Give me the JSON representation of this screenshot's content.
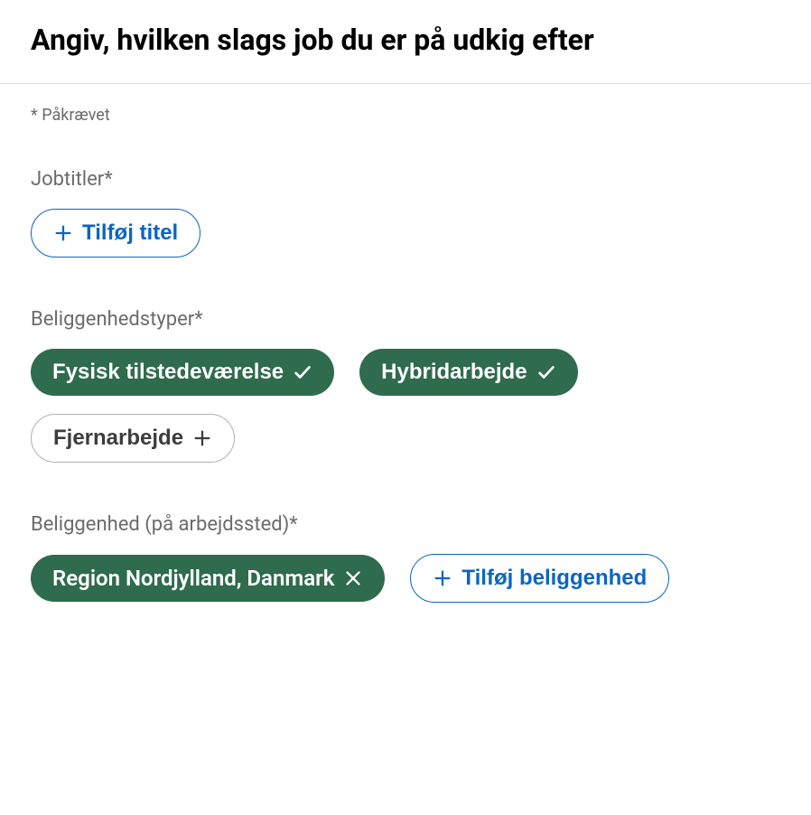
{
  "page": {
    "title": "Angiv, hvilken slags job du er på udkig efter",
    "required_hint": "* Påkrævet"
  },
  "jobTitles": {
    "label": "Jobtitler*",
    "addButton": "Tilføj titel"
  },
  "locationTypes": {
    "label": "Beliggenhedstyper*",
    "options": [
      {
        "label": "Fysisk tilstedeværelse",
        "selected": true
      },
      {
        "label": "Hybridarbejde",
        "selected": true
      },
      {
        "label": "Fjernarbejde",
        "selected": false
      }
    ]
  },
  "location": {
    "label": "Beliggenhed (på arbejdssted)*",
    "chips": [
      {
        "label": "Region Nordjylland, Danmark"
      }
    ],
    "addButton": "Tilføj beliggenhed"
  }
}
